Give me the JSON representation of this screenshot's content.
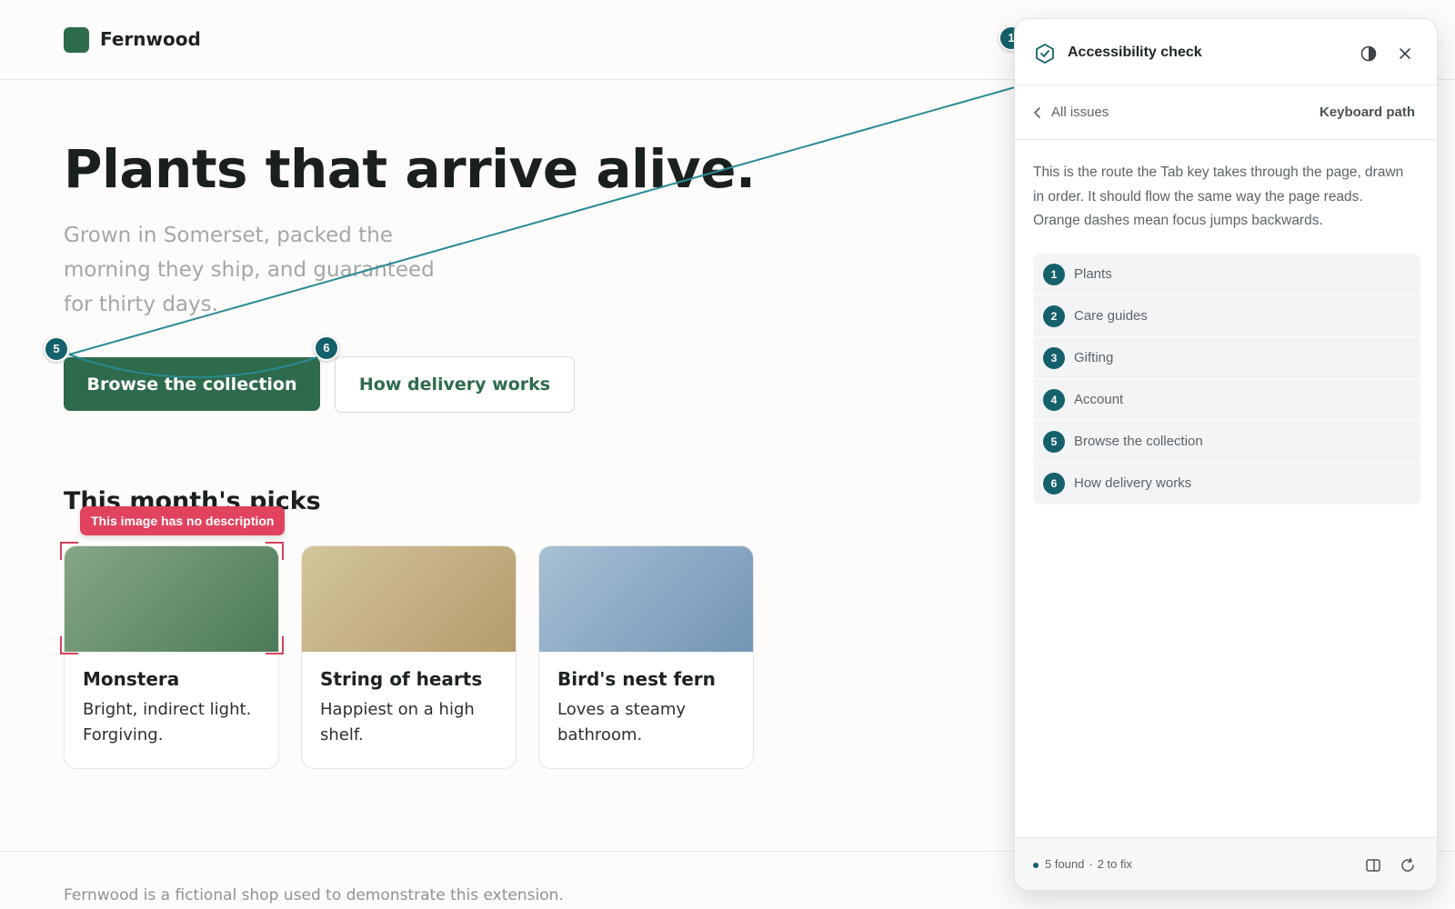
{
  "site": {
    "brand": "Fernwood",
    "colors": {
      "brand_green": "#2e6b4c",
      "panel_teal": "#14616b",
      "alert_red": "#e1435e"
    }
  },
  "hero": {
    "title": "Plants that arrive alive.",
    "subtitle": "Grown in Somerset, packed the morning they ship, and guaranteed for thirty days.",
    "primary_cta": "Browse the collection",
    "secondary_cta": "How delivery works"
  },
  "picks": {
    "title": "This month's picks",
    "missing_alt_badge": "This image has no description",
    "cards": [
      {
        "name": "Monstera",
        "desc": "Bright, indirect light. Forgiving."
      },
      {
        "name": "String of hearts",
        "desc": "Happiest on a high shelf."
      },
      {
        "name": "Bird's nest fern",
        "desc": "Loves a steamy bathroom."
      }
    ]
  },
  "footer": {
    "text": "Fernwood is a fictional shop used to demonstrate this extension."
  },
  "tab_markers": [
    {
      "num": "1"
    },
    {
      "num": "5"
    },
    {
      "num": "6"
    }
  ],
  "panel": {
    "title": "Accessibility check",
    "icons": {
      "header": "shield-check-icon",
      "contrast": "contrast-icon",
      "close": "close-icon",
      "back": "chevron-left-icon",
      "dock": "dock-panel-icon",
      "refresh": "refresh-icon"
    },
    "back_label": "All issues",
    "section": "Keyboard path",
    "description": "This is the route the Tab key takes through the page, drawn in order. It should flow the same way the page reads. Orange dashes mean focus jumps backwards.",
    "path": [
      {
        "num": "1",
        "label": "Plants"
      },
      {
        "num": "2",
        "label": "Care guides"
      },
      {
        "num": "3",
        "label": "Gifting"
      },
      {
        "num": "4",
        "label": "Account"
      },
      {
        "num": "5",
        "label": "Browse the collection"
      },
      {
        "num": "6",
        "label": "How delivery works"
      }
    ],
    "found": "5 found",
    "separator": "·",
    "to_fix": "2 to fix"
  }
}
